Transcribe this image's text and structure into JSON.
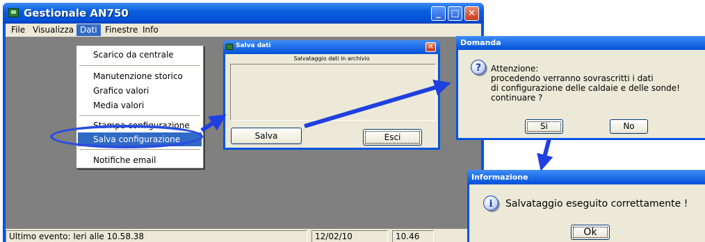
{
  "main_window": {
    "title": "Gestionale AN750",
    "menu": [
      "File",
      "Visualizza",
      "Dati",
      "Finestre",
      "Info"
    ],
    "title_buttons": {
      "minimize": "_",
      "maximize": "□",
      "close": "✕"
    },
    "status": {
      "event": "Ultimo evento: Ieri alle 10.58.38",
      "date": "12/02/10",
      "time": "10.46"
    }
  },
  "dati_menu": {
    "items": [
      "Scarico da centrale",
      "Manutenzione storico",
      "Grafico valori",
      "Media valori",
      "Stampa configurazione",
      "Salva configurazione",
      "Notifiche email"
    ],
    "highlighted": "Salva configurazione"
  },
  "salva_dialog": {
    "title": "Salva dati",
    "caption": "Salvataggio dati in archivio",
    "save_label": "Salva",
    "exit_label": "Esci",
    "close_glyph": "✕"
  },
  "domanda_dialog": {
    "title": "Domanda",
    "icon": "?",
    "lines": [
      "Attenzione:",
      "procedendo verranno sovrascritti i dati",
      "di configurazione delle caldaie e delle sonde!",
      "continuare ?"
    ],
    "yes_label": "Si",
    "no_label": "No"
  },
  "info_dialog": {
    "title": "Informazione",
    "icon": "i",
    "message": "Salvataggio eseguito correttamente !",
    "ok_label": "Ok"
  },
  "colors": {
    "arrow": "#1f3fe0",
    "highlight": "#316ac5",
    "titlebar": "#0054e3"
  }
}
